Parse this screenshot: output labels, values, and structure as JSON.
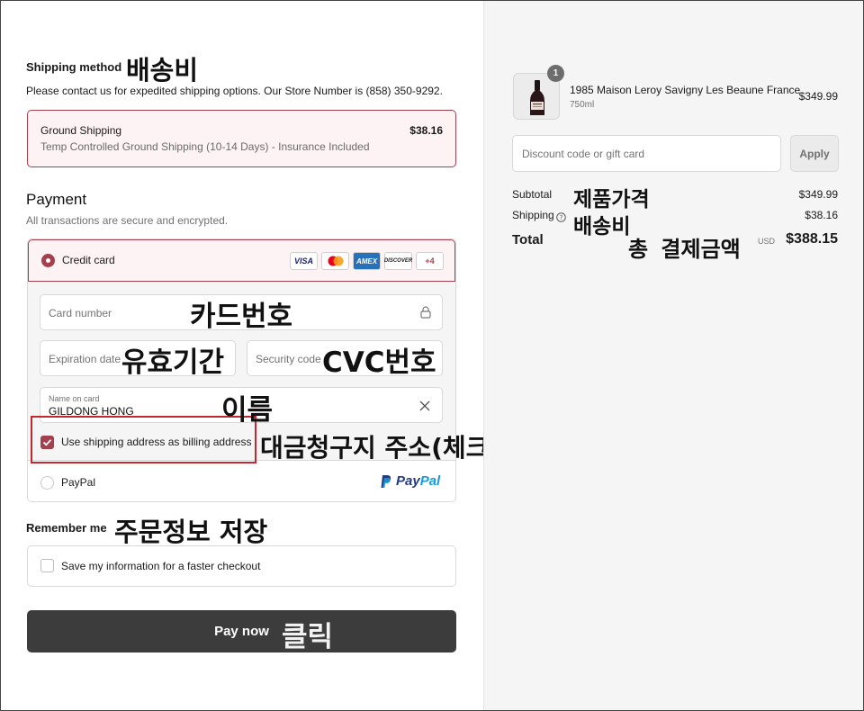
{
  "shipping": {
    "heading": "Shipping method",
    "note": "Please contact us for expedited shipping options. Our Store Number is (858) 350-9292.",
    "option_name": "Ground Shipping",
    "option_desc": "Temp Controlled Ground Shipping (10-14 Days) - Insurance Included",
    "option_price": "$38.16"
  },
  "payment": {
    "heading": "Payment",
    "subtitle": "All transactions are secure and encrypted.",
    "credit_card_label": "Credit card",
    "card_logos": [
      "VISA",
      "mastercard",
      "AMEX",
      "DISCOVER"
    ],
    "more_cards": "+4",
    "card_number_placeholder": "Card number",
    "expiration_placeholder": "Expiration date",
    "security_placeholder": "Security code",
    "name_label": "Name on card",
    "name_value": "GILDONG HONG",
    "billing_checkbox_label": "Use shipping address as billing address",
    "paypal_label": "PayPal",
    "paypal_logo_left": "Pay",
    "paypal_logo_right": "Pal"
  },
  "remember": {
    "heading": "Remember me",
    "checkbox_label": "Save my information for a faster checkout"
  },
  "pay_button": "Pay now",
  "summary": {
    "item": {
      "name": "1985 Maison Leroy Savigny Les Beaune France",
      "variant": "750ml",
      "price": "$349.99",
      "quantity": "1"
    },
    "discount_placeholder": "Discount code or gift card",
    "apply_label": "Apply",
    "subtotal_label": "Subtotal",
    "subtotal_value": "$349.99",
    "shipping_label": "Shipping",
    "shipping_value": "$38.16",
    "total_label": "Total",
    "total_currency": "USD",
    "total_value": "$388.15"
  },
  "annotations": {
    "shipping_cost": "배송비",
    "card_number": "카드번호",
    "expiration": "유효기간",
    "cvc": "CVC번호",
    "name": "이름",
    "billing": "대금청구지 주소(체크o)",
    "remember": "주문정보 저장",
    "click": "클릭",
    "product_price": "제품가격",
    "summary_shipping": "배송비",
    "total_amount": "총 결제금액"
  },
  "colors": {
    "accent": "#a2404e",
    "accent_bg": "#fdf3f4",
    "button_dark": "#3c3c3c",
    "annotation_box": "#c4282f"
  }
}
